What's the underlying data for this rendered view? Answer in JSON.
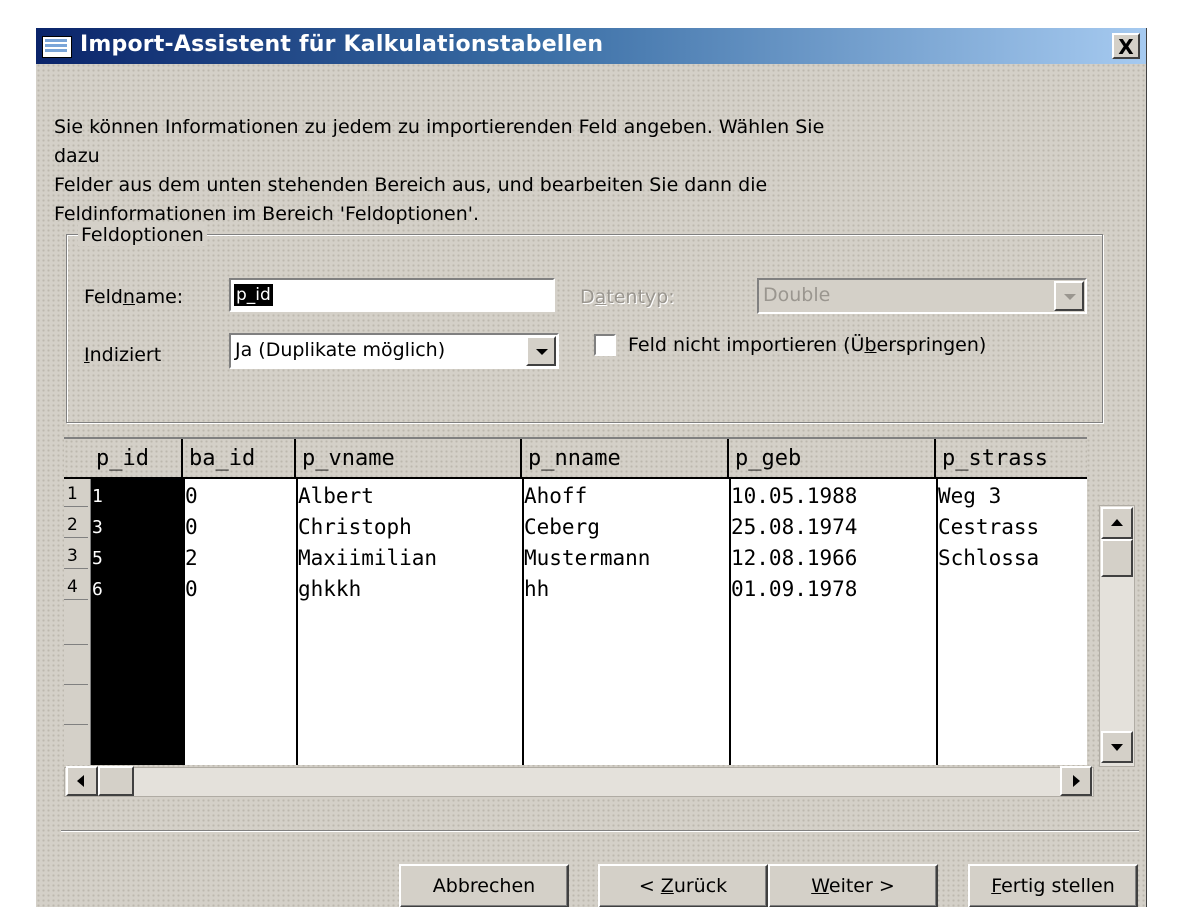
{
  "window": {
    "title": "Import-Assistent für Kalkulationstabellen",
    "close_label": "X"
  },
  "intro": {
    "line1": "Sie können Informationen zu jedem zu importierenden Feld angeben. Wählen Sie dazu",
    "line2": "Felder aus dem unten stehenden Bereich aus, und bearbeiten Sie dann die",
    "line3": "Feldinformationen im Bereich 'Feldoptionen'."
  },
  "field_options": {
    "legend": "Feldoptionen",
    "fieldname_label_pre": "Feld",
    "fieldname_label_u": "n",
    "fieldname_label_post": "ame:",
    "fieldname_value": "p_id",
    "datatype_label_pre": "D",
    "datatype_label_u": "a",
    "datatype_label_post": "tentyp:",
    "datatype_value": "Double",
    "indexed_label_u": "I",
    "indexed_label_post": "ndiziert",
    "indexed_value": "Ja (Duplikate möglich)",
    "skip_label_pre": "Feld nicht importieren (Ü",
    "skip_label_u": "b",
    "skip_label_post": "erspringen)",
    "skip_checked": false
  },
  "grid": {
    "columns": [
      "p_id",
      "ba_id",
      "p_vname",
      "p_nname",
      "p_geb",
      "p_strass"
    ],
    "row_numbers": [
      "1",
      "2",
      "3",
      "4"
    ],
    "rows": [
      [
        "1",
        "0",
        "Albert",
        "Ahoff",
        "10.05.1988",
        "Weg 3"
      ],
      [
        "3",
        "0",
        "Christoph",
        "Ceberg",
        "25.08.1974",
        "Cestrass"
      ],
      [
        "5",
        "2",
        "Maxiimilian",
        "Mustermann",
        "12.08.1966",
        "Schlossa"
      ],
      [
        "6",
        "0",
        "ghkkh",
        "hh",
        "01.09.1978",
        ""
      ]
    ],
    "selected_column": "p_id"
  },
  "buttons": {
    "cancel": "Abbrechen",
    "back_pre": "< ",
    "back_u": "Z",
    "back_post": "urück",
    "next_u": "W",
    "next_post": "eiter >",
    "finish_u": "F",
    "finish_post": "ertig stellen"
  },
  "colors": {
    "titlebar_start": "#0a246a",
    "titlebar_end": "#a6caf0",
    "dialog_face": "#d4d0c8",
    "selection": "#000000"
  }
}
